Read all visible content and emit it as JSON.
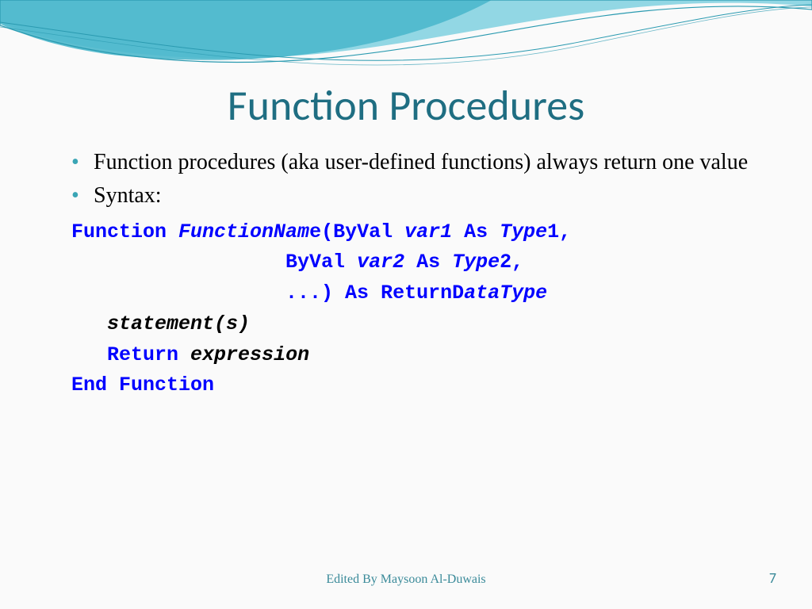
{
  "title": "Function Procedures",
  "bullets": [
    "Function procedures (aka user-defined functions) always return one value",
    "Syntax:"
  ],
  "code": {
    "l1_kw1": "Function ",
    "l1_ital1": "FunctionNam",
    "l1_kw2": "e(ByVal ",
    "l1_ital2": "var1",
    "l1_kw3": " As ",
    "l1_ital3": "Type",
    "l1_kw4": "1,",
    "l2_pad": "                  ",
    "l2_kw1": "ByVal ",
    "l2_ital1": "var2",
    "l2_kw2": " As ",
    "l2_ital2": "Type",
    "l2_kw3": "2,",
    "l3_pad": "                  ",
    "l3_kw1": "...) As ReturnD",
    "l3_ital1": "ataType",
    "l4_pad": "   ",
    "l4_ital": "statement(s)",
    "l5_pad": "   ",
    "l5_kw": "Return ",
    "l5_ital": "expression",
    "l6_kw": "End Function"
  },
  "footer": "Edited By Maysoon Al-Duwais",
  "page": "7"
}
